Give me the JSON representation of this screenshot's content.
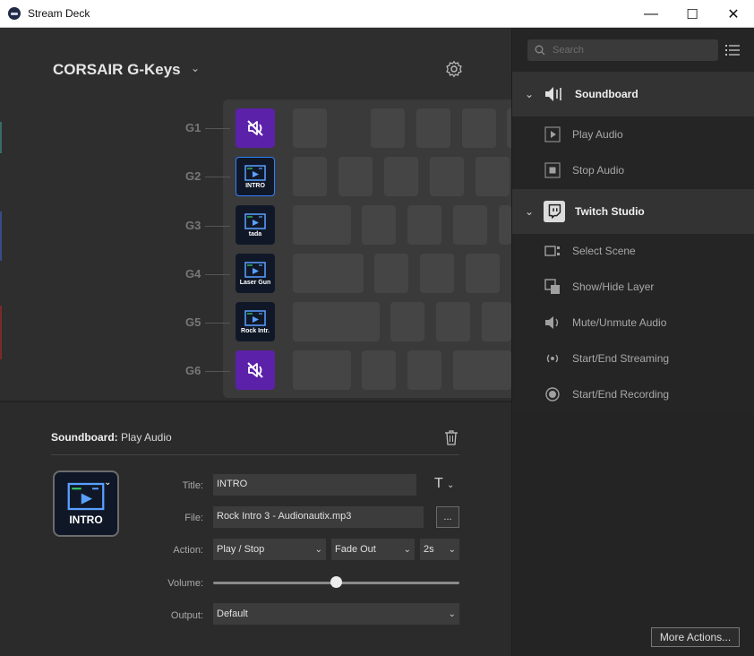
{
  "window": {
    "title": "Stream Deck",
    "min": "—",
    "max": "☐",
    "close": "✕"
  },
  "device": {
    "name": "CORSAIR G-Keys",
    "chevron": "⌄"
  },
  "gkeys": [
    {
      "label": "G1",
      "key_text": ""
    },
    {
      "label": "G2",
      "key_text": "INTRO"
    },
    {
      "label": "G3",
      "key_text": "tada"
    },
    {
      "label": "G4",
      "key_text": "Laser Gun"
    },
    {
      "label": "G5",
      "key_text": "Rock Intr."
    },
    {
      "label": "G6",
      "key_text": ""
    }
  ],
  "properties": {
    "plugin": "Soundboard:",
    "action": " Play Audio",
    "key_label": "INTRO",
    "title_label": "Title:",
    "title_value": "INTRO",
    "file_label": "File:",
    "file_value": "Rock Intro 3 - Audionautix.mp3",
    "browse": "...",
    "action_label": "Action:",
    "action_value": "Play / Stop",
    "fade_value": "Fade Out",
    "fade_time": "2s",
    "volume_label": "Volume:",
    "volume_fraction": 0.5,
    "output_label": "Output:",
    "output_value": "Default"
  },
  "sidebar": {
    "search_placeholder": "Search",
    "categories": [
      {
        "label": "Soundboard",
        "icon": "speaker-icon",
        "actions": [
          {
            "label": "Play Audio",
            "icon": "play-audio-icon"
          },
          {
            "label": "Stop Audio",
            "icon": "stop-audio-icon"
          }
        ]
      },
      {
        "label": "Twitch Studio",
        "icon": "twitch-icon",
        "actions": [
          {
            "label": "Select Scene",
            "icon": "scene-icon"
          },
          {
            "label": "Show/Hide Layer",
            "icon": "layer-icon"
          },
          {
            "label": "Mute/Unmute Audio",
            "icon": "mute-icon"
          },
          {
            "label": "Start/End Streaming",
            "icon": "streaming-icon"
          },
          {
            "label": "Start/End Recording",
            "icon": "recording-icon"
          }
        ]
      }
    ],
    "more_actions": "More Actions..."
  },
  "colors": {
    "accent_blue": "#2f7fff",
    "key_purple": "#5b21a8",
    "key_navy": "#101828"
  }
}
